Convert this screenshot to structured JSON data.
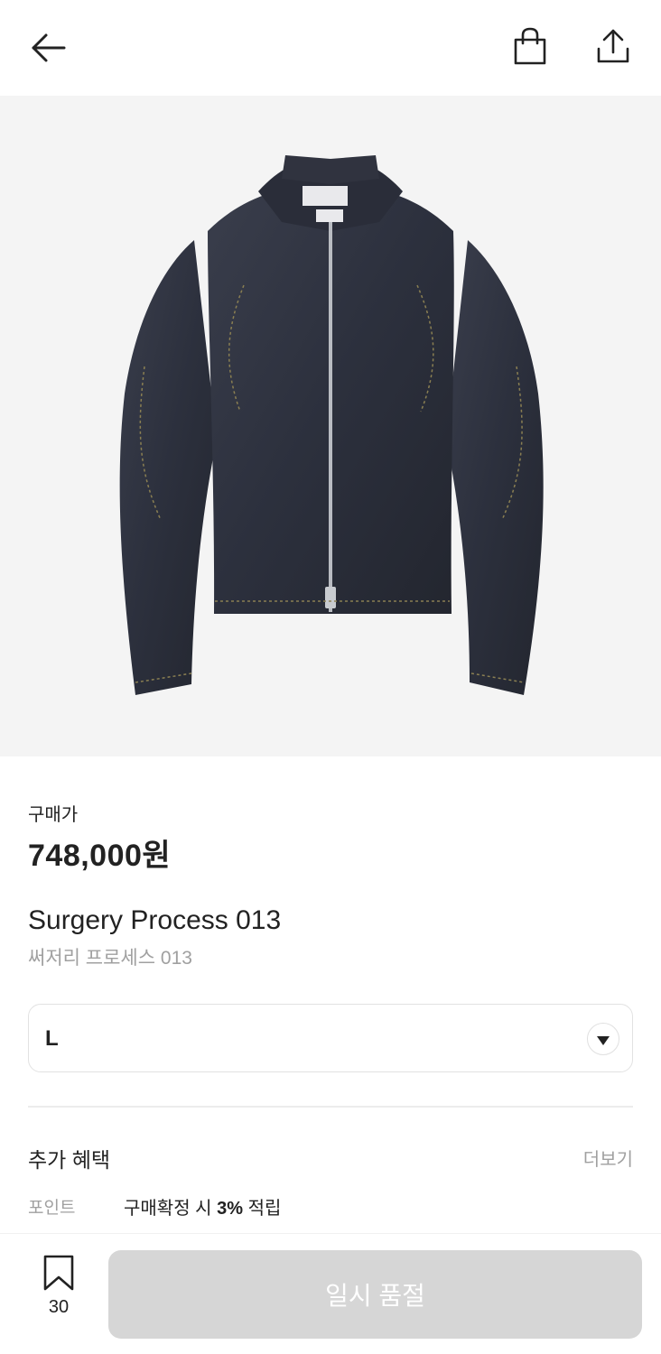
{
  "header": {
    "back_icon": "arrow-left-icon",
    "cart_icon": "shopping-bag-icon",
    "share_icon": "share-icon"
  },
  "product": {
    "image": "navy denim zip jacket",
    "price_label": "구매가",
    "price": "748,000원",
    "name_en": "Surgery Process 013",
    "name_ko": "써저리 프로세스 013"
  },
  "size_select": {
    "selected": "L",
    "icon": "chevron-down-icon"
  },
  "benefits": {
    "title": "추가 혜택",
    "more": "더보기",
    "point_label": "포인트",
    "point_prefix": "구매확정 시 ",
    "point_rate": "3%",
    "point_suffix": " 적립"
  },
  "bottom": {
    "bookmark_icon": "bookmark-icon",
    "bookmark_count": "30",
    "button_label": "일시 품절"
  }
}
